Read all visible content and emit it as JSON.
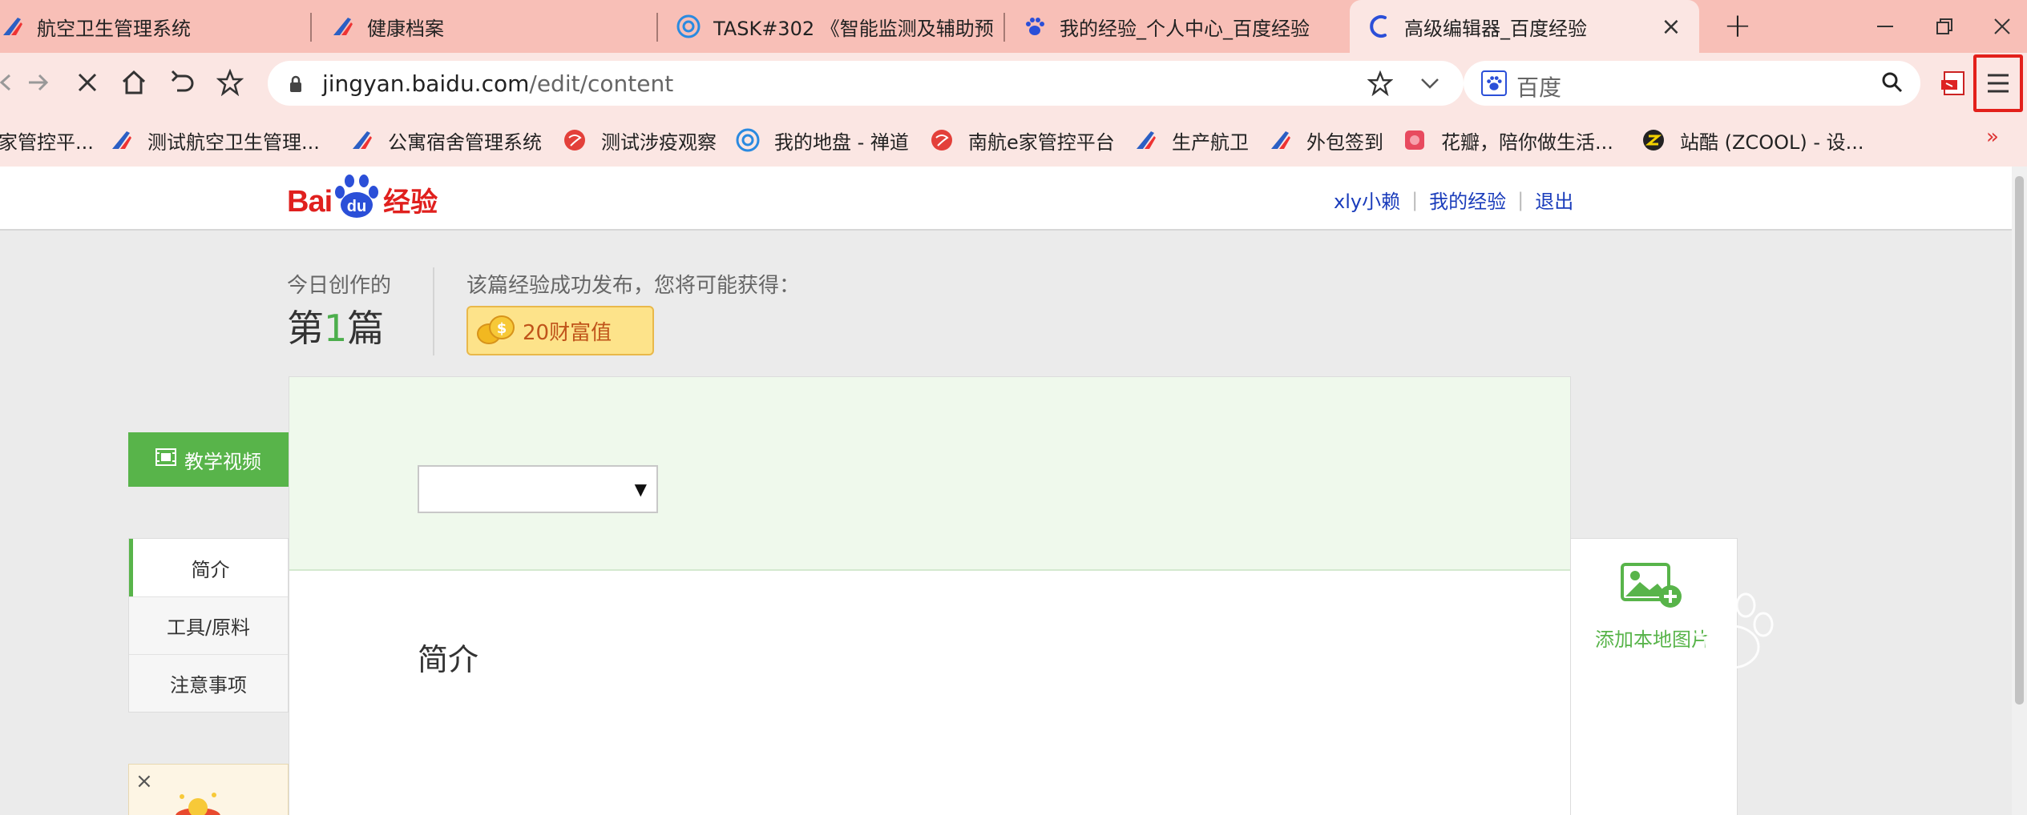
{
  "browser": {
    "tabs": [
      {
        "title": "航空卫生管理系统",
        "icon": "airline-icon"
      },
      {
        "title": "健康档案",
        "icon": "airline-icon"
      },
      {
        "title": "TASK#302 《智能监测及辅助预",
        "icon": "chandao-icon"
      },
      {
        "title": "我的经验_个人中心_百度经验",
        "icon": "baidu-paw-icon"
      },
      {
        "title": "高级编辑器_百度经验",
        "icon": "loading-icon",
        "active": true
      }
    ],
    "url_host": "jingyan.baidu.com",
    "url_path": "/edit/content",
    "search_placeholder": "百度",
    "bookmarks": [
      {
        "label": "家管控平...",
        "icon": ""
      },
      {
        "label": "测试航空卫生管理...",
        "icon": "airline-icon"
      },
      {
        "label": "公寓宿舍管理系统",
        "icon": "airline-icon"
      },
      {
        "label": "测试涉疫观察",
        "icon": "globe-icon"
      },
      {
        "label": "我的地盘 - 禅道",
        "icon": "chandao-icon"
      },
      {
        "label": "南航e家管控平台",
        "icon": "globe-icon"
      },
      {
        "label": "生产航卫",
        "icon": "airline-icon"
      },
      {
        "label": "外包签到",
        "icon": "airline-icon"
      },
      {
        "label": "花瓣，陪你做生活...",
        "icon": "huaban-icon"
      },
      {
        "label": "站酷 (ZCOOL) - 设...",
        "icon": "zcool-icon"
      }
    ],
    "bookmarks_more": "»"
  },
  "site": {
    "logo_text_left": "Bai",
    "logo_text_paw": "du",
    "logo_text_right": "经验",
    "user_name": "xly小赖",
    "my_experience": "我的经验",
    "logout": "退出"
  },
  "stats": {
    "today_label": "今日创作的",
    "count_prefix": "第",
    "count_value": "1",
    "count_suffix": "篇",
    "publish_label": "该篇经验成功发布，您将可能获得：",
    "reward_amount": "20",
    "reward_unit": "财富值"
  },
  "sidebar": {
    "video_button": "教学视频",
    "nav_items": [
      {
        "label": "简介",
        "active": true
      },
      {
        "label": "工具/原料",
        "active": false
      },
      {
        "label": "注意事项",
        "active": false
      }
    ],
    "ad_close": "×"
  },
  "editor": {
    "category_value": "",
    "section_title": "简介"
  },
  "addimg": {
    "label": "添加本地图片"
  },
  "colors": {
    "tab_bar": "#f8bfb7",
    "toolbar": "#fbe6e3",
    "accent_green": "#58b44a",
    "link_blue": "#1a3cbb",
    "brand_red": "#e0201e",
    "menu_highlight": "#e3201b"
  }
}
